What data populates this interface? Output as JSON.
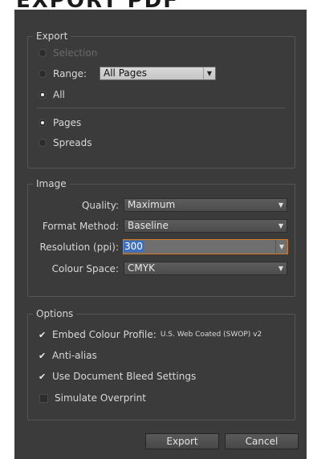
{
  "header": {
    "cut_title": "EXPORT PDF"
  },
  "export": {
    "legend": "Export",
    "selection_label": "Selection",
    "range_label": "Range:",
    "range_value": "All Pages",
    "all_label": "All",
    "pages_label": "Pages",
    "spreads_label": "Spreads",
    "selected_scope": "All",
    "selected_layout": "Pages"
  },
  "image": {
    "legend": "Image",
    "quality_label": "Quality:",
    "quality_value": "Maximum",
    "format_label": "Format Method:",
    "format_value": "Baseline",
    "resolution_label": "Resolution (ppi):",
    "resolution_value": "300",
    "colour_label": "Colour Space:",
    "colour_value": "CMYK"
  },
  "options": {
    "legend": "Options",
    "embed_label": "Embed Colour Profile:",
    "embed_profile": "U.S. Web Coated (SWOP) v2",
    "embed_checked": true,
    "antialias_label": "Anti-alias",
    "antialias_checked": true,
    "bleed_label": "Use Document Bleed Settings",
    "bleed_checked": true,
    "overprint_label": "Simulate Overprint",
    "overprint_checked": false
  },
  "buttons": {
    "export": "Export",
    "cancel": "Cancel"
  },
  "colors": {
    "dialog_bg": "#3b3b3b",
    "focus_border": "#d27a2c",
    "text_highlight": "#3b6fc1"
  },
  "icons": {
    "dropdown": "chevron-down-icon",
    "check": "checkmark-icon"
  }
}
